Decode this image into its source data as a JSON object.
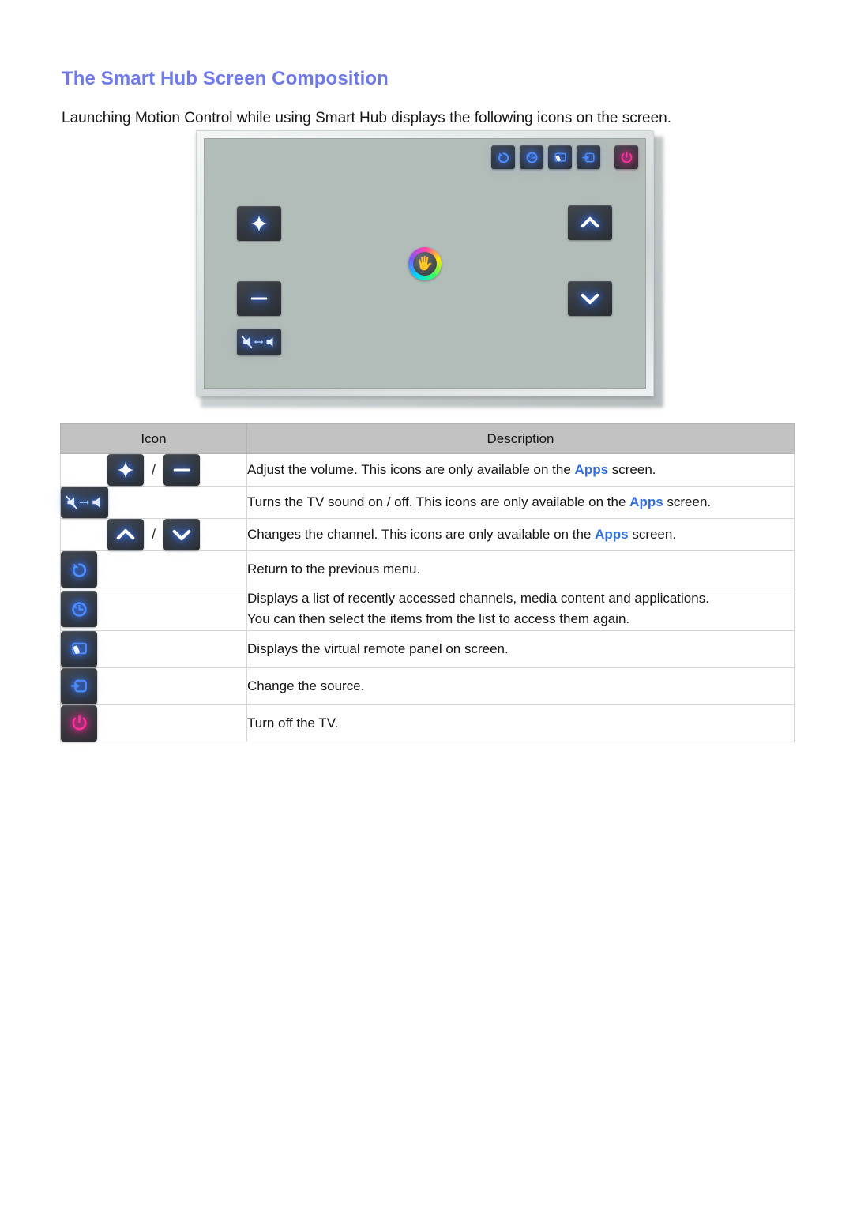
{
  "page": {
    "title": "The Smart Hub Screen Composition",
    "intro": "Launching Motion Control while using Smart Hub displays the following icons on the screen.",
    "title_color": "#6f79e8",
    "accent_link_color": "#2f6fe0"
  },
  "tv_illustration": {
    "screen_color": "#b2bcb8",
    "bezel_color": "#e3e7e8",
    "top_icons": [
      {
        "name": "return-icon",
        "label": "Return"
      },
      {
        "name": "history-icon",
        "label": "Recent"
      },
      {
        "name": "virtual-remote-icon",
        "label": "Virtual Remote"
      },
      {
        "name": "source-icon",
        "label": "Source"
      },
      {
        "name": "power-icon",
        "label": "Power"
      }
    ],
    "side_icons": [
      {
        "name": "volume-up-icon",
        "label": "Volume Up"
      },
      {
        "name": "volume-down-icon",
        "label": "Volume Down"
      },
      {
        "name": "mute-toggle-icon",
        "label": "Mute On / Off"
      },
      {
        "name": "channel-up-icon",
        "label": "Channel Up"
      },
      {
        "name": "channel-down-icon",
        "label": "Channel Down"
      }
    ],
    "cursor": {
      "name": "hand-cursor",
      "label": "Motion Control hand cursor"
    }
  },
  "table": {
    "headers": {
      "icon": "Icon",
      "description": "Description"
    },
    "rows": [
      {
        "icons": [
          "volume-up-icon",
          "volume-down-icon"
        ],
        "separator": "/",
        "desc_before": "Adjust the volume. This icons are only available on the ",
        "desc_keyword": "Apps",
        "desc_after": " screen.",
        "desc_line2": ""
      },
      {
        "icons": [
          "mute-toggle-icon"
        ],
        "separator": "",
        "desc_before": "Turns the TV sound on / off. This icons are only available on the ",
        "desc_keyword": "Apps",
        "desc_after": " screen.",
        "desc_line2": ""
      },
      {
        "icons": [
          "channel-up-icon",
          "channel-down-icon"
        ],
        "separator": "/",
        "desc_before": "Changes the channel. This icons are only available on the ",
        "desc_keyword": "Apps",
        "desc_after": " screen.",
        "desc_line2": ""
      },
      {
        "icons": [
          "return-icon"
        ],
        "separator": "",
        "desc_before": "Return to the previous menu.",
        "desc_keyword": "",
        "desc_after": "",
        "desc_line2": ""
      },
      {
        "icons": [
          "history-icon"
        ],
        "separator": "",
        "desc_before": "Displays a list of recently accessed channels, media content and applications.",
        "desc_keyword": "",
        "desc_after": "",
        "desc_line2": "You can then select the items from the list to access them again."
      },
      {
        "icons": [
          "virtual-remote-icon"
        ],
        "separator": "",
        "desc_before": "Displays the virtual remote panel on screen.",
        "desc_keyword": "",
        "desc_after": "",
        "desc_line2": ""
      },
      {
        "icons": [
          "source-icon"
        ],
        "separator": "",
        "desc_before": "Change the source.",
        "desc_keyword": "",
        "desc_after": "",
        "desc_line2": ""
      },
      {
        "icons": [
          "power-icon"
        ],
        "separator": "",
        "desc_before": "Turn off the TV.",
        "desc_keyword": "",
        "desc_after": "",
        "desc_line2": ""
      }
    ]
  }
}
